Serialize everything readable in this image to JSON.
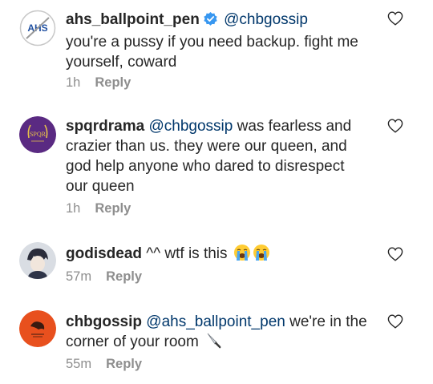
{
  "comments": [
    {
      "username": "ahs_ballpoint_pen",
      "verified": true,
      "mention": "@chbgossip",
      "text": "you're a pussy if you need backup. fight me yourself, coward",
      "time": "1h",
      "reply_label": "Reply",
      "avatar_text": "AHS"
    },
    {
      "username": "spqrdrama",
      "mention": "@chbgossip",
      "text": "was fearless and crazier than us. they were our queen, and god help anyone who dared to disrespect our queen",
      "time": "1h",
      "reply_label": "Reply",
      "avatar_text": "SPQR"
    },
    {
      "username": "godisdead",
      "text": "^^ wtf is this",
      "emojis": [
        "loudly-crying-face",
        "loudly-crying-face"
      ],
      "time": "57m",
      "reply_label": "Reply"
    },
    {
      "username": "chbgossip",
      "mention": "@ahs_ballpoint_pen",
      "text": "we're in the corner of your room",
      "emojis": [
        "knife"
      ],
      "time": "55m",
      "reply_label": "Reply"
    }
  ],
  "colors": {
    "mention": "#00376b",
    "meta": "#8e8e8e",
    "verified": "#3897f0",
    "spqr_avatar": "#5a2a82",
    "chb_avatar": "#e8501e"
  }
}
